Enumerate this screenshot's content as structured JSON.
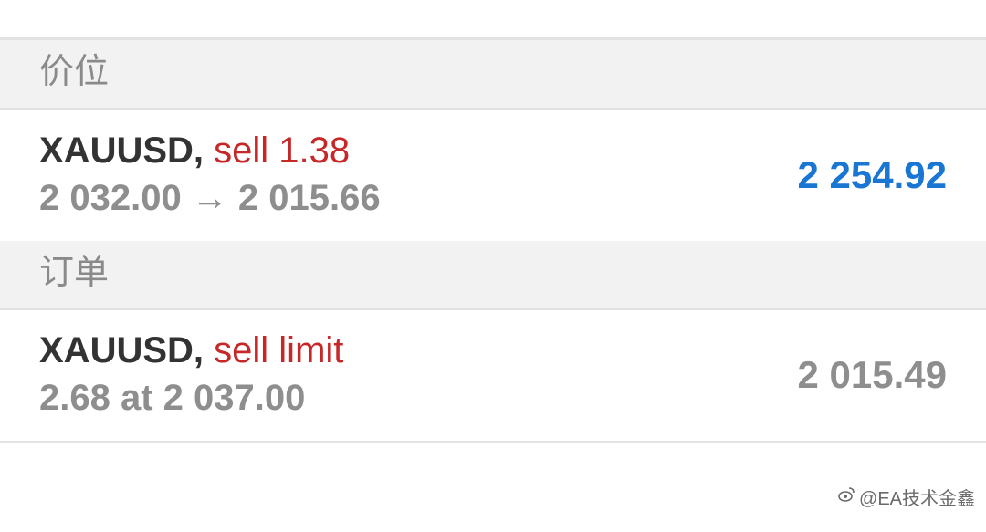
{
  "sections": {
    "positions": {
      "title": "价位",
      "item": {
        "symbol": "XAUUSD,",
        "trade": "sell 1.38",
        "price_line": "2 032.00 → 2 015.66",
        "profit": "2 254.92"
      }
    },
    "orders": {
      "title": "订单",
      "item": {
        "symbol": "XAUUSD,",
        "trade": "sell limit",
        "detail_line": "2.68 at 2 037.00",
        "current_price": "2 015.49"
      }
    }
  },
  "colors": {
    "symbol": "#333333",
    "trade_type": "#c62828",
    "profit": "#1976d2",
    "secondary": "#8e8e8e",
    "header_bg": "#f2f2f2",
    "divider": "#e2e2e2"
  },
  "watermark": {
    "icon": "weibo-logo-icon",
    "text": "@EA技术金鑫"
  }
}
